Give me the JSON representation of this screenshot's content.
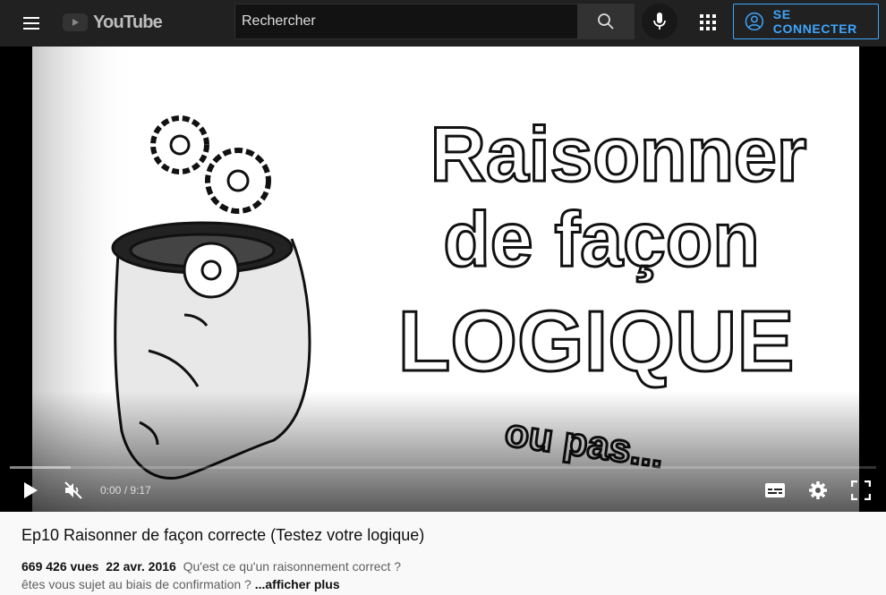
{
  "header": {
    "logo_text": "YouTube",
    "search_placeholder": "Rechercher",
    "signin_label": "SE CONNECTER"
  },
  "player": {
    "thumbnail_text": {
      "line1": "Raisonner",
      "line2": "de façon",
      "line3": "LOGIQUE",
      "line4": "ou pas..."
    },
    "time_current": "0:00",
    "time_separator": " / ",
    "time_total": "9:17",
    "progress_buffered_fraction": 0.07
  },
  "video": {
    "title": "Ep10 Raisonner de façon correcte (Testez votre logique)",
    "views": "669 426 vues",
    "date": "22 avr. 2016",
    "description_line1": "Qu'est ce qu'un raisonnement correct ?",
    "description_line2": "êtes vous sujet au biais de confirmation ?",
    "show_more_label": "...afficher plus"
  },
  "colors": {
    "topbar": "#212121",
    "accent_blue": "#3ea6ff",
    "page_bg": "#f9f9f9"
  }
}
